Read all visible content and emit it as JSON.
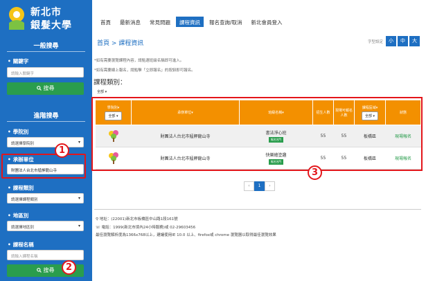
{
  "logo": {
    "line1": "新北市",
    "line2": "銀髮大學"
  },
  "sidebar": {
    "general_search_title": "一般搜尋",
    "keyword_label": "關鍵字",
    "keyword_placeholder": "請輸入關鍵字",
    "search_button": "搜尋",
    "advanced_search_title": "進階搜尋",
    "faculty_label": "學院別",
    "faculty_value": "請選擇學院別",
    "unit_label": "承辦單位",
    "unit_value": "財團法人台北市艋舺龍山寺",
    "category_label": "課程類別",
    "category_value": "請選擇課程類別",
    "district_label": "地區別",
    "district_value": "請選擇地區別",
    "course_name_label": "課程名稱",
    "course_name_placeholder": "請輸入課程名稱",
    "search_button2": "搜尋"
  },
  "callouts": {
    "one": "1",
    "two": "2",
    "three": "3"
  },
  "nav": {
    "items": [
      "首頁",
      "最新消息",
      "常見問題",
      "課程資訊",
      "報名查詢/取消",
      "新北會員登入"
    ],
    "active_index": 3
  },
  "breadcrumb": "首頁 > 課程資訊",
  "font_size": {
    "label": "字型設定",
    "small": "小",
    "medium": "中",
    "large": "大"
  },
  "notes": [
    "*如有需要瀏覽課程內容，請點選班級名稱即可進入。",
    "*如有需要線上報名，請點擊「立即報名」的按鈕即可報名。"
  ],
  "category_title": "課程類別：",
  "category_select": "全部",
  "table": {
    "headers": {
      "faculty": "學院別",
      "faculty_select": "全部",
      "unit": "承辦單位",
      "course": "班級名稱",
      "enrolled": "招生人數",
      "available": "現場可報名人數",
      "district": "課程區域",
      "district_select": "全部",
      "status": "狀態"
    },
    "rows": [
      {
        "unit": "財團法人台北市艋舺龍山寺",
        "course": "書法淨心班",
        "tag": "報名名門",
        "enrolled": "55",
        "available": "55",
        "district": "板橋區",
        "status": "現場報名"
      },
      {
        "unit": "財團法人台北市艋舺龍山寺",
        "course": "快樂繪塗趣",
        "tag": "報名名門",
        "enrolled": "55",
        "available": "55",
        "district": "板橋區",
        "status": "現場報名"
      }
    ]
  },
  "pager": {
    "prev": "‹",
    "current": "1",
    "next": "›"
  },
  "footer": {
    "address": "地址：(22001)新北市板橋區中山路1段161號",
    "phone": "電話：1999(新北市境內24小時服務)或 02-29603456",
    "browser": "最佳瀏覽解析度為1366x768以上，建議使用IE 10.0 以上、firefox或  chrome 瀏覽器以取得最佳瀏覽效果"
  },
  "colors": {
    "sidebar": "#1e6fc2",
    "header": "#f39000",
    "green": "#2a9d4d",
    "callout": "#e3151a"
  }
}
